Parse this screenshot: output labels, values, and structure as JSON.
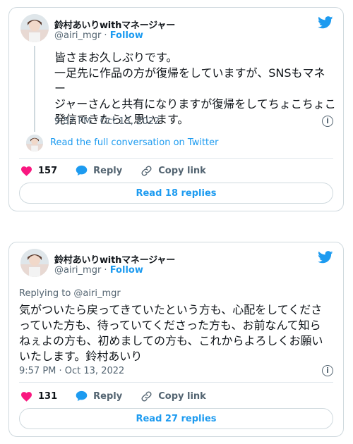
{
  "tweets": [
    {
      "author_name": "鈴村あいりwithマネージャー",
      "author_handle": "@airi_mgr",
      "separator": " · ",
      "follow_label": "Follow",
      "text": "皆さまお久しぶりです。\n一足先に作品の方が復帰をしていますが、SNSもマネー\nジャーさんと共有になりますが復帰をしてちょこちょこ\n発信できたらと思います。",
      "timestamp": "9:57 PM · Oct 13, 2022",
      "full_conversation_label": "Read the full conversation on Twitter",
      "like_count": "157",
      "reply_label": "Reply",
      "copy_link_label": "Copy link",
      "read_replies_label": "Read 18 replies"
    },
    {
      "author_name": "鈴村あいりwithマネージャー",
      "author_handle": "@airi_mgr",
      "separator": " · ",
      "follow_label": "Follow",
      "replying_to": "Replying to @airi_mgr",
      "text": "気がついたら戻ってきていたという方も、心配をしてくださ\nっていた方も、待っていてくださった方も、お前なんて知ら\nねぇよの方も、初めましての方も、これからよろしくお願い\nいたします。鈴村あいり",
      "timestamp": "9:57 PM · Oct 13, 2022",
      "like_count": "131",
      "reply_label": "Reply",
      "copy_link_label": "Copy link",
      "read_replies_label": "Read 27 replies"
    }
  ],
  "colors": {
    "accent": "#1d9bf0",
    "like": "#f91880",
    "muted": "#536471",
    "border": "#cfd9de"
  },
  "icons": [
    "twitter-bird-icon",
    "heart-icon",
    "reply-bubble-icon",
    "link-icon",
    "info-icon"
  ]
}
